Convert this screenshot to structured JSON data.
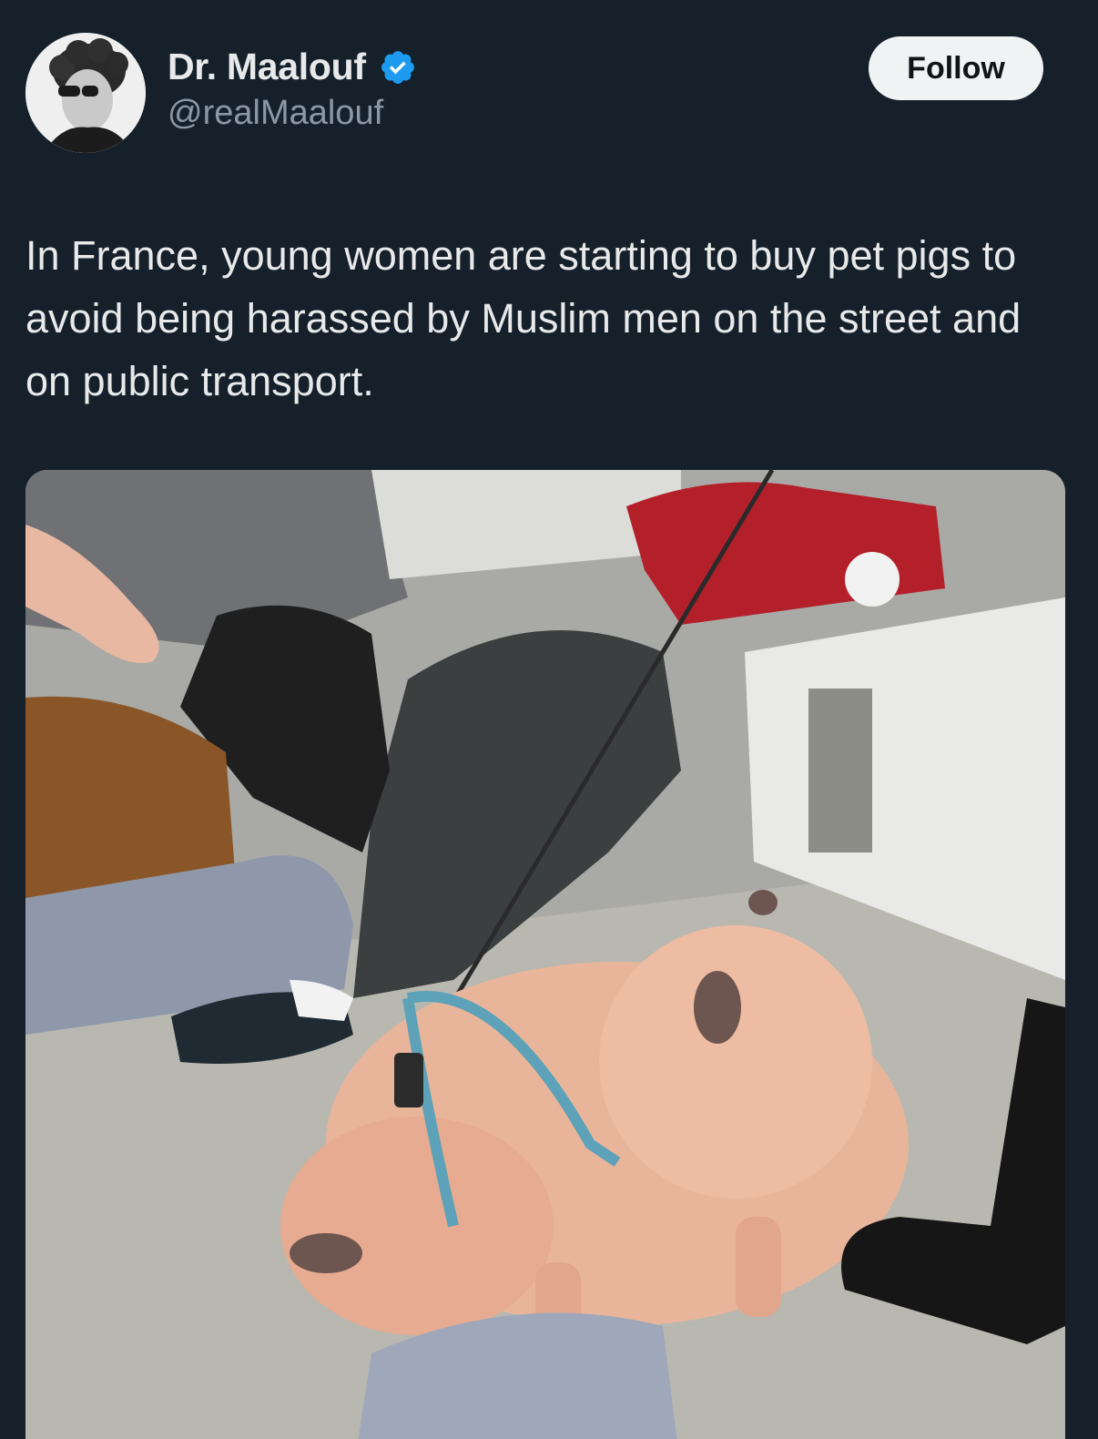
{
  "author": {
    "display_name": "Dr. Maalouf",
    "handle": "@realMaalouf",
    "verified": true,
    "avatar_icon": "profile-photo"
  },
  "follow_button": {
    "label": "Follow"
  },
  "tweet": {
    "text": "In France, young women are starting to buy pet pigs to avoid being harassed by Muslim men on the street and on public transport."
  },
  "media": {
    "type": "video-still",
    "icon": "video-thumbnail"
  },
  "colors": {
    "background": "#15202b",
    "text_primary": "#e7e9ea",
    "text_secondary": "#8b98a5",
    "verified_badge": "#1d9bf0",
    "follow_button_bg": "#eff3f4",
    "follow_button_text": "#0f1419"
  }
}
